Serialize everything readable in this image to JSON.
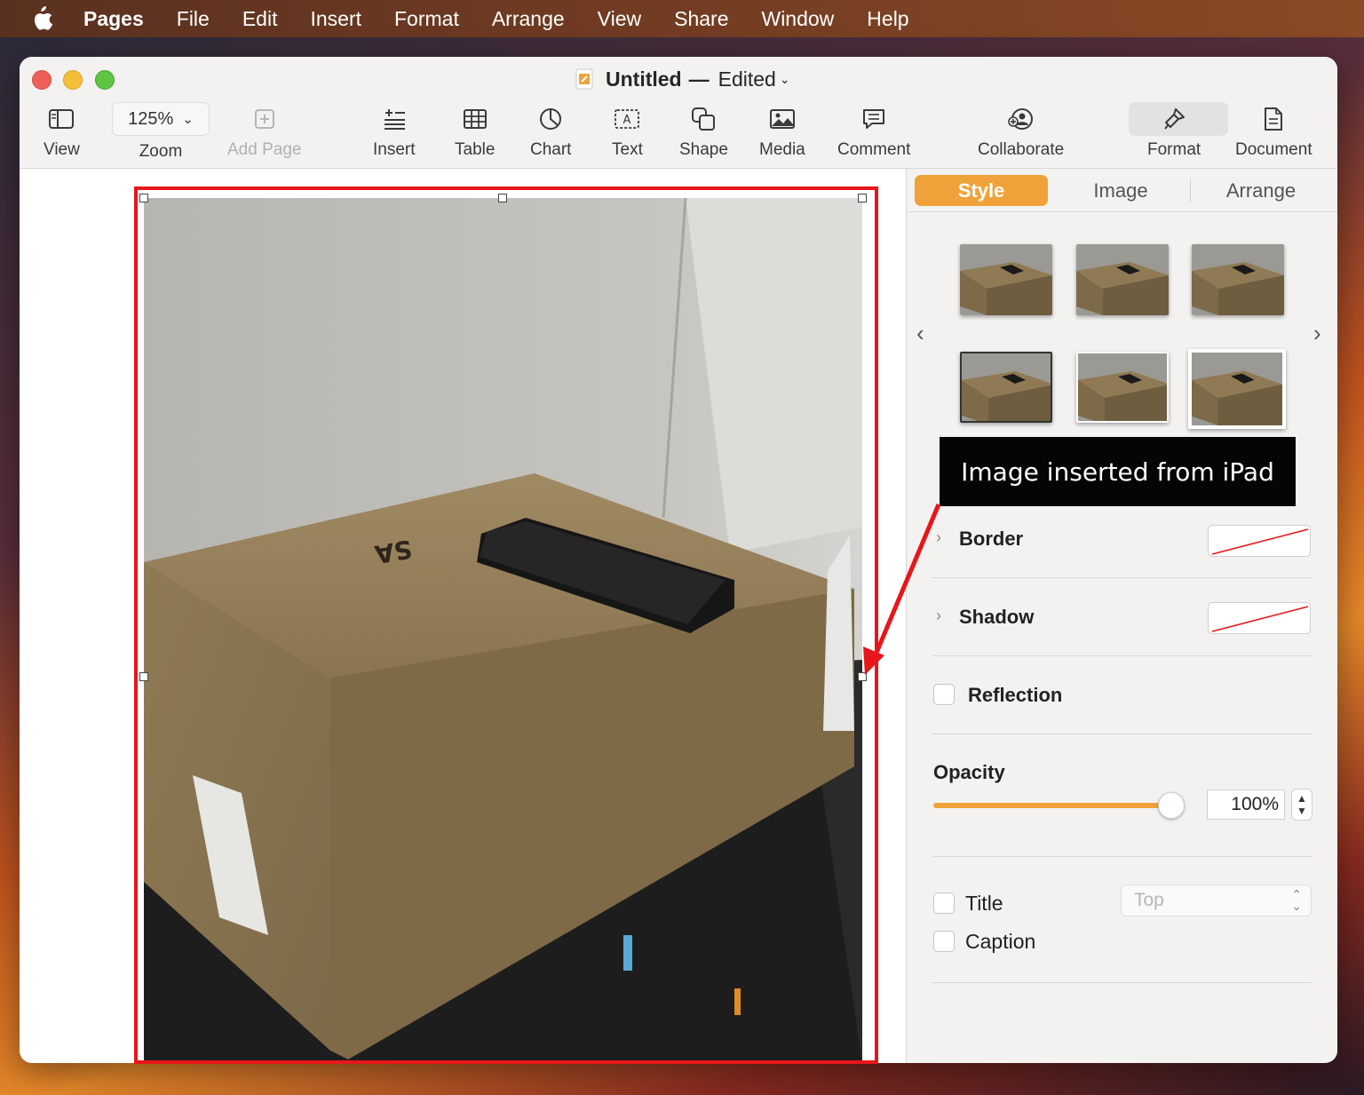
{
  "menubar": {
    "app": "Pages",
    "items": [
      "File",
      "Edit",
      "Insert",
      "Format",
      "Arrange",
      "View",
      "Share",
      "Window",
      "Help"
    ]
  },
  "window": {
    "doc_name": "Untitled",
    "separator": "—",
    "status": "Edited"
  },
  "toolbar": {
    "view": "View",
    "zoom_value": "125%",
    "zoom": "Zoom",
    "add_page": "Add Page",
    "insert": "Insert",
    "table": "Table",
    "chart": "Chart",
    "text": "Text",
    "shape": "Shape",
    "media": "Media",
    "comment": "Comment",
    "collaborate": "Collaborate",
    "format": "Format",
    "document": "Document"
  },
  "inspector": {
    "tabs": [
      "Style",
      "Image",
      "Arrange"
    ],
    "border_label": "Border",
    "shadow_label": "Shadow",
    "reflection_label": "Reflection",
    "opacity_label": "Opacity",
    "opacity_value": "100%",
    "title_label": "Title",
    "title_position": "Top",
    "caption_label": "Caption"
  },
  "annotation": {
    "callout_text": "Image inserted from iPad"
  },
  "colors": {
    "accent": "#f0a23a",
    "annotation_red": "#e8161b"
  }
}
